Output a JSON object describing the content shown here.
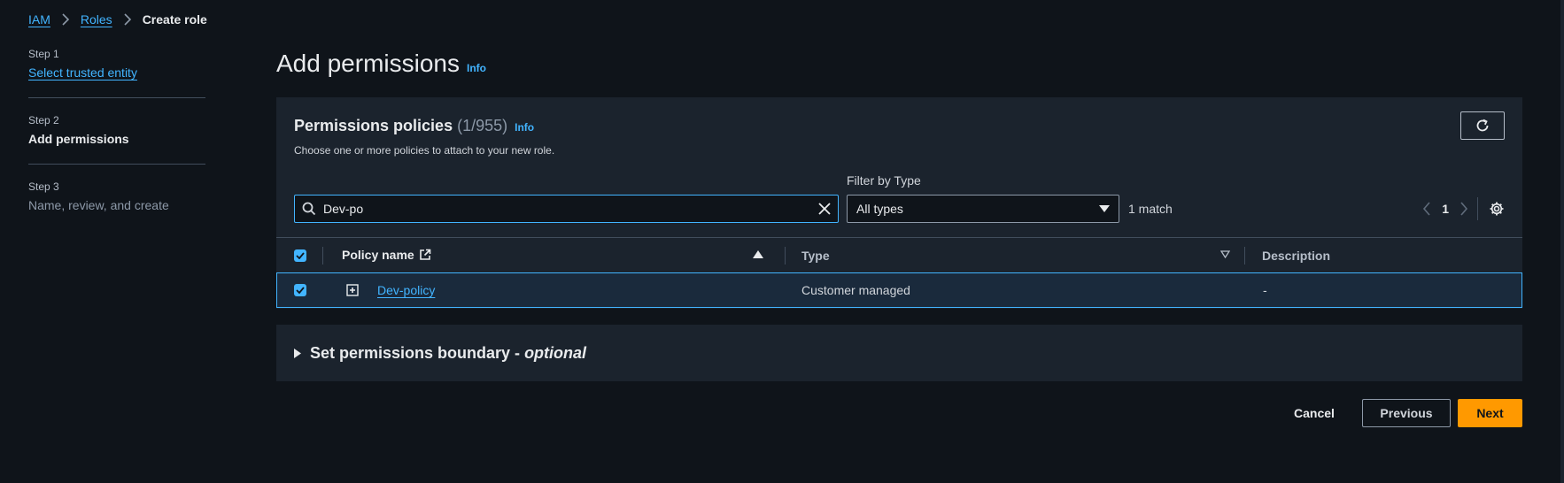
{
  "breadcrumb": {
    "iam": "IAM",
    "roles": "Roles",
    "current": "Create role"
  },
  "steps": [
    {
      "num": "Step 1",
      "label": "Select trusted entity"
    },
    {
      "num": "Step 2",
      "label": "Add permissions"
    },
    {
      "num": "Step 3",
      "label": "Name, review, and create"
    }
  ],
  "page": {
    "title": "Add permissions",
    "info": "Info"
  },
  "panel": {
    "title": "Permissions policies",
    "count": "(1/955)",
    "info": "Info",
    "description": "Choose one or more policies to attach to your new role.",
    "search_value": "Dev-po",
    "filter_label": "Filter by Type",
    "filter_value": "All types",
    "match": "1 match",
    "page_number": "1"
  },
  "table": {
    "headers": {
      "policy_name": "Policy name",
      "type": "Type",
      "description": "Description"
    },
    "rows": [
      {
        "name": "Dev-policy",
        "type": "Customer managed",
        "description": "-"
      }
    ]
  },
  "boundary": {
    "label": "Set permissions boundary - ",
    "optional": "optional"
  },
  "buttons": {
    "cancel": "Cancel",
    "previous": "Previous",
    "next": "Next"
  },
  "colors": {
    "accent": "#42b4ff",
    "primary_button": "#ff9900",
    "background": "#0f141a",
    "panel": "#1b232d"
  }
}
